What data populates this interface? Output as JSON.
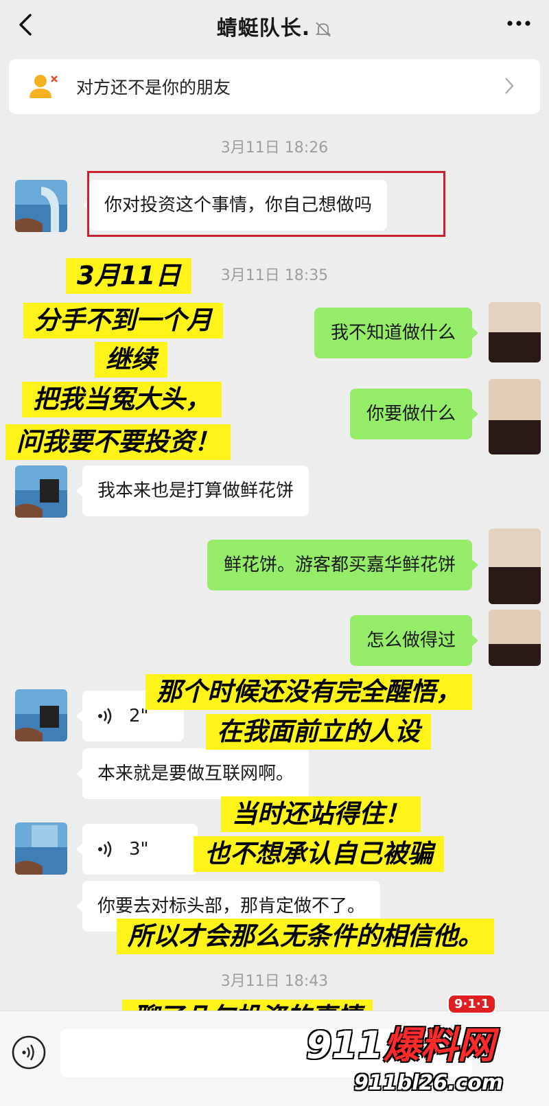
{
  "header": {
    "title": "蜻蜓队长.",
    "icons": [
      "back-icon",
      "mute-icon",
      "more-icon"
    ]
  },
  "banner": {
    "text": "对方还不是你的朋友",
    "icon": "add-friend-icon"
  },
  "timestamps": {
    "t1": "3月11日 18:26",
    "t2": "3月11日 18:35",
    "t3": "3月11日 18:43"
  },
  "messages": {
    "m1": "你对投资这个事情，你自己想做吗",
    "m2": "我不知道做什么",
    "m3": "你要做什么",
    "m4": "我本来也是打算做鲜花饼",
    "m5": "鲜花饼。游客都买嘉华鲜花饼",
    "m6": "怎么做得过",
    "v1": "2\"",
    "m7": "本来就是要做互联网啊。",
    "v2": "3\"",
    "m8": "你要去对标头部，那肯定做不了。"
  },
  "annotations": {
    "a1": "3月11日",
    "a2": "分手不到一个月",
    "a3": "继续",
    "a4": "把我当冤大头，",
    "a5": "问我要不要投资！",
    "a6": "那个时候还没有完全醒悟，",
    "a7": "在我面前立的人设",
    "a8": "当时还站得住！",
    "a9": "也不想承认自己被骗",
    "a10": "所以才会那么无条件的相信他。",
    "a11": "聊了几句投资的事情"
  },
  "watermark": {
    "part1": "911",
    "part2": "爆料网",
    "url": "911bl26.com",
    "badge": "9·1·1"
  },
  "colors": {
    "outgoing_bubble": "#95ec69",
    "highlight": "#fff41a",
    "frame": "#c8202f"
  }
}
